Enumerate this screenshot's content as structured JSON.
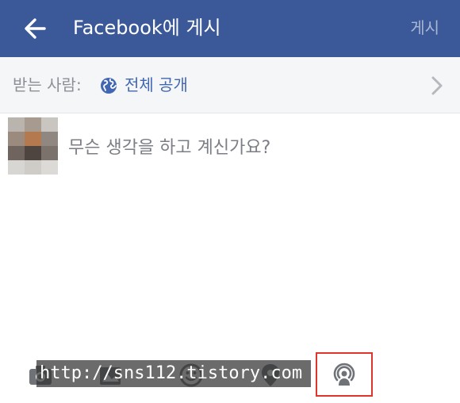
{
  "header": {
    "title": "Facebook에 게시",
    "post_label": "게시",
    "back_icon": "arrow-left-icon",
    "background": "#3b5998"
  },
  "audience": {
    "label": "받는 사람:",
    "value": "전체 공개",
    "icon": "globe-icon",
    "chevron_icon": "chevron-right-icon"
  },
  "composer": {
    "prompt": "무슨 생각을 하고 계신가요?",
    "avatar": "blurred-profile-photo"
  },
  "toolbar": {
    "icons": [
      "camera-icon",
      "photo-album-icon",
      "emoji-icon",
      "location-pin-icon",
      "live-video-icon"
    ],
    "highlight_color": "#e0342c"
  },
  "watermark": {
    "text": "http://sns112.tistory.com"
  }
}
